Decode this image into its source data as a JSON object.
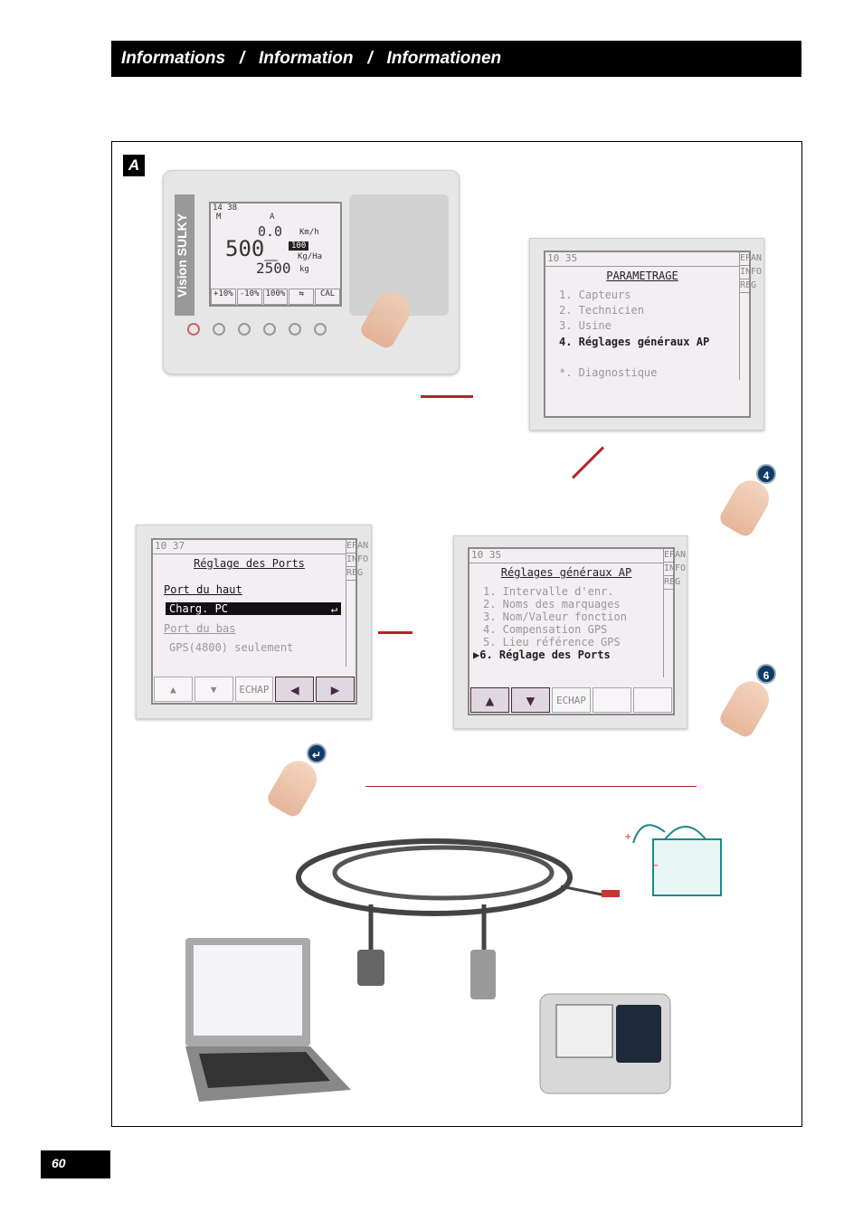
{
  "header": {
    "title_fr": "Informations",
    "sep": "/",
    "title_en": "Information",
    "title_de": "Informationen"
  },
  "figure_label": "A",
  "page_number": "60",
  "device": {
    "brand": "SULKY",
    "model": "Vision",
    "time": "14 38",
    "mode": "M",
    "row2_center": "A",
    "speed": "0.0",
    "speed_unit": "Km/h",
    "rate": "500_",
    "rate_unit": "Kg/Ha",
    "percent": "100",
    "weight": "2500",
    "weight_unit": "kg",
    "buttons": [
      "+10%",
      "-10%",
      "100%",
      "",
      "CAL"
    ]
  },
  "side_tabs": [
    "EPAN",
    "INFO",
    "REG"
  ],
  "screen_param": {
    "time": "10 35",
    "title": "PARAMETRAGE",
    "items": [
      "1. Capteurs",
      "2. Technicien",
      "3. Usine",
      "4. Réglages généraux AP",
      "*. Diagnostique"
    ]
  },
  "screen_reglages": {
    "time": "10 35",
    "title": "Réglages généraux AP",
    "items": [
      "1. Intervalle d'enr.",
      "2. Noms des marquages",
      "3. Nom/Valeur fonction",
      "4. Compensation GPS",
      "5. Lieu référence GPS",
      "6. Réglage des Ports"
    ],
    "buttons": [
      "▲",
      "▼",
      "ECHAP",
      "",
      ""
    ]
  },
  "screen_ports": {
    "time": "10 37",
    "title": "Réglage des Ports",
    "port_haut": "Port du haut",
    "port_haut_value": "Charg. PC",
    "port_bas": "Port du bas",
    "port_bas_value": "GPS(4800) seulement",
    "buttons": [
      "▲",
      "▼",
      "ECHAP",
      "◀",
      "▶"
    ]
  },
  "steps": [
    "4",
    "6"
  ],
  "colors": {
    "arrow": "#b5222a",
    "header": "#000000"
  }
}
